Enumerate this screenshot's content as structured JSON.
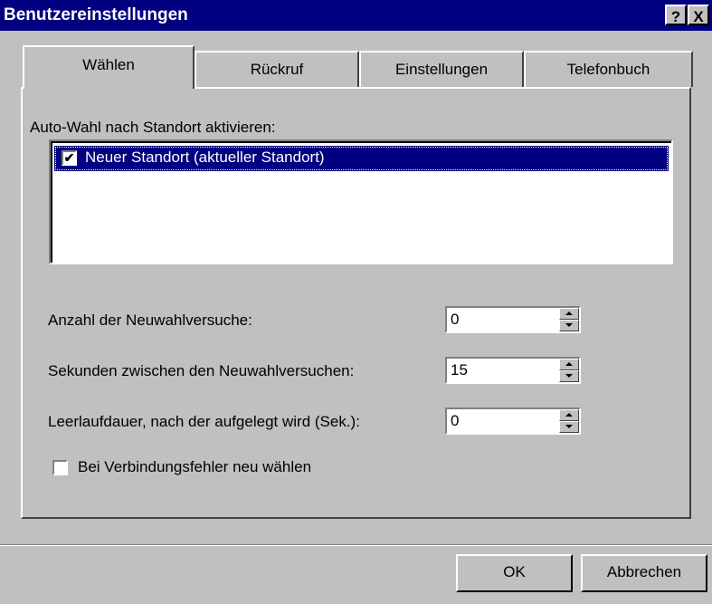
{
  "window": {
    "title": "Benutzereinstellungen",
    "help_glyph": "?",
    "close_glyph": "X"
  },
  "tabs": [
    {
      "label": "Wählen",
      "active": true
    },
    {
      "label": "Rückruf",
      "active": false
    },
    {
      "label": "Einstellungen",
      "active": false
    },
    {
      "label": "Telefonbuch",
      "active": false
    }
  ],
  "autodial": {
    "label": "Auto-Wahl nach Standort aktivieren:",
    "items": [
      {
        "label": "Neuer Standort (aktueller Standort)",
        "checked": true
      }
    ],
    "check_glyph": "✔"
  },
  "fields": [
    {
      "label": "Anzahl der Neuwahlversuche:",
      "value": "0"
    },
    {
      "label": "Sekunden zwischen den Neuwahlversuchen:",
      "value": "15"
    },
    {
      "label": "Leerlaufdauer, nach der aufgelegt wird (Sek.):",
      "value": "0"
    }
  ],
  "redial_on_error": {
    "label": "Bei Verbindungsfehler neu wählen",
    "checked": false
  },
  "buttons": {
    "ok": "OK",
    "cancel": "Abbrechen"
  },
  "colors": {
    "face": "#c0c0c0",
    "titlebar": "#000080",
    "selection": "#000080"
  }
}
